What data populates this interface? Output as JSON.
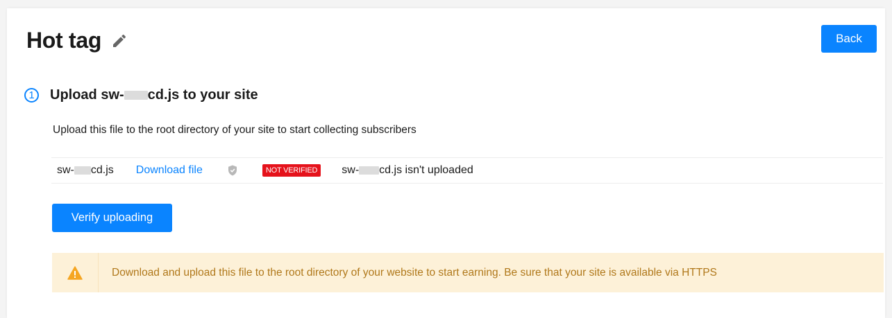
{
  "header": {
    "title": "Hot tag",
    "back_label": "Back"
  },
  "step": {
    "number": "1",
    "title_prefix": "Upload sw-",
    "title_suffix": "cd.js to your site",
    "description": "Upload this file to the root directory of your site to start collecting subscribers"
  },
  "file": {
    "name_prefix": "sw-",
    "name_suffix": "cd.js",
    "download_label": "Download file",
    "status_badge": "NOT VERIFIED",
    "status_prefix": "sw-",
    "status_suffix": "cd.js isn't uploaded"
  },
  "actions": {
    "verify_label": "Verify uploading"
  },
  "alert": {
    "text": "Download and upload this file to the root directory of your website to start earning. Be sure that your site is available via HTTPS"
  },
  "colors": {
    "accent": "#0a84ff",
    "badge_red": "#e5121b",
    "alert_bg": "#fdf1d8",
    "alert_text": "#b0781a",
    "warning_icon": "#f5a623"
  },
  "icons": {
    "edit": "pencil-icon",
    "shield": "shield-check-icon",
    "warning": "warning-triangle-icon"
  }
}
